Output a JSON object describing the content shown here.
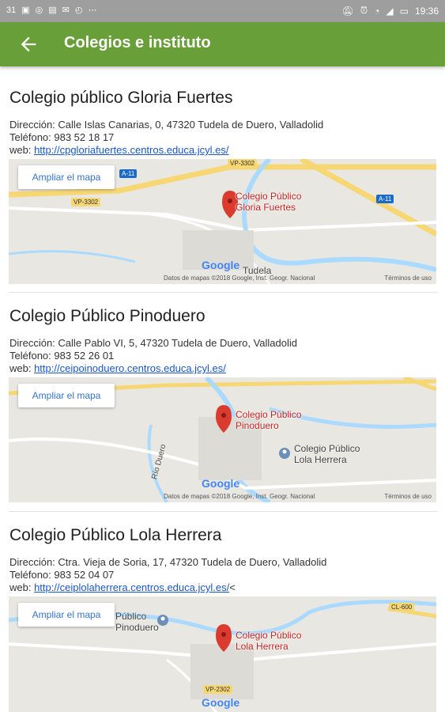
{
  "status_bar": {
    "left_icons": [
      "31",
      "msg-icon",
      "whatsapp-icon",
      "image-icon",
      "mail-icon",
      "clock-icon",
      "more-icon"
    ],
    "time": "19:36"
  },
  "app_bar": {
    "title": "Colegios e instituto"
  },
  "labels": {
    "address_prefix": "Dirección: ",
    "phone_prefix": "Teléfono: ",
    "web_prefix": "web: "
  },
  "map_common": {
    "ampliar_label": "Ampliar el mapa",
    "attribution": "Datos de mapas ©2018 Google, Inst. Geogr. Nacional",
    "terms": "Términos de uso",
    "google_logo": "Google"
  },
  "schools": [
    {
      "name": "Colegio público Gloria Fuertes",
      "address": "Calle Islas Canarias, 0, 47320 Tudela de Duero, Valladolid",
      "phone": "983 52 18 17",
      "web": "http://cpgloriafuertes.centros.educa.jcyl.es/",
      "web_suffix": "",
      "map": {
        "pin_label": "Colegio Público\nGloria Fuertes",
        "road_labels": [
          "VP-3302",
          "A-11",
          "VP-3302",
          "A-11"
        ],
        "place_labels": [
          "Tudela"
        ]
      }
    },
    {
      "name": "Colegio Público Pinoduero",
      "address": "Calle Pablo VI, 5, 47320 Tudela de Duero, Valladolid",
      "phone": "983 52 26 01",
      "web": "http://ceipoinoduero.centros.educa.jcyl.es/",
      "web_suffix": "",
      "map": {
        "pin_label": "Colegio Público\nPinoduero",
        "poi_label": "Colegio Público\nLola Herrera",
        "place_labels": [
          "Río Duero"
        ]
      }
    },
    {
      "name": "Colegio Público Lola Herrera",
      "address": "Ctra. Vieja de Soria, 17, 47320 Tudela de Duero, Valladolid",
      "phone": "983 52 04 07",
      "web": "http://ceiplolaherrera.centros.educa.jcyl.es/",
      "web_suffix": "<",
      "map": {
        "pin_label": "Colegio Público\nLola Herrera",
        "poi_label": "Público\nPinoduero",
        "road_labels": [
          "CL-600",
          "VP-2302"
        ]
      }
    }
  ],
  "colors": {
    "app_bar": "#689f38",
    "status_bar": "#9e9e9e",
    "link": "#1a56c9",
    "pin": "#db3b2f"
  }
}
